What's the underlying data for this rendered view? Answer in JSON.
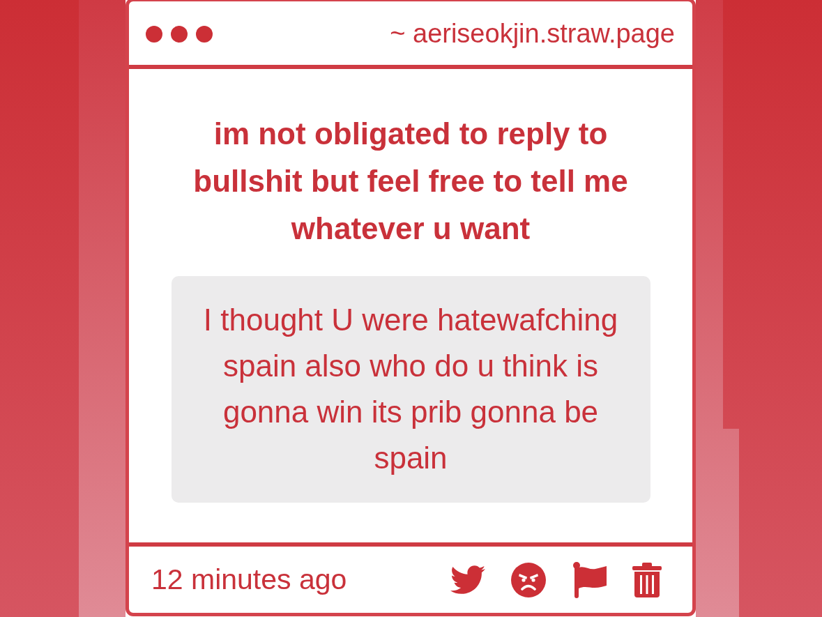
{
  "header": {
    "url": "~ aeriseokjin.straw.page"
  },
  "post": {
    "question": "im not obligated to reply to bullshit but feel free to tell me whatever u want",
    "message": "I thought U were hatewafching spain also who do u think is gonna win its prib gonna be spain"
  },
  "footer": {
    "time": "12 minutes ago"
  }
}
